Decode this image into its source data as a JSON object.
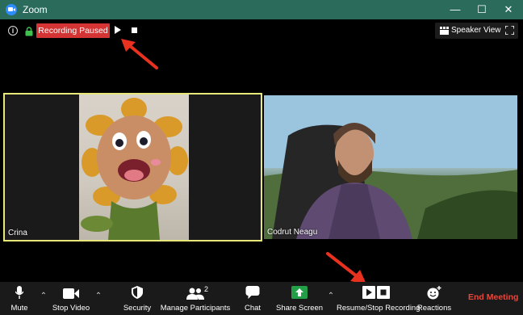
{
  "window": {
    "title": "Zoom",
    "controls": [
      "minimize-icon",
      "maximize-icon",
      "close-icon"
    ]
  },
  "top_bar": {
    "recording_status": "Recording Paused",
    "speaker_view_label": "Speaker View"
  },
  "participants": [
    {
      "name": "Crina",
      "active_speaker": true
    },
    {
      "name": "Codrut Neagu",
      "active_speaker": false
    }
  ],
  "toolbar": {
    "mute_label": "Mute",
    "stop_video_label": "Stop Video",
    "security_label": "Security",
    "manage_participants_label": "Manage Participants",
    "participants_count": "2",
    "chat_label": "Chat",
    "share_screen_label": "Share Screen",
    "recording_label": "Resume/Stop Recording",
    "reactions_label": "Reactions",
    "end_meeting_label": "End Meeting"
  },
  "colors": {
    "title_bar": "#2a6b5c",
    "recording_badge": "#d43434",
    "active_speaker_border": "#e8e87a",
    "share_screen_green": "#23a047",
    "end_meeting": "#e8463b",
    "annotation_arrow": "#e8311e"
  }
}
